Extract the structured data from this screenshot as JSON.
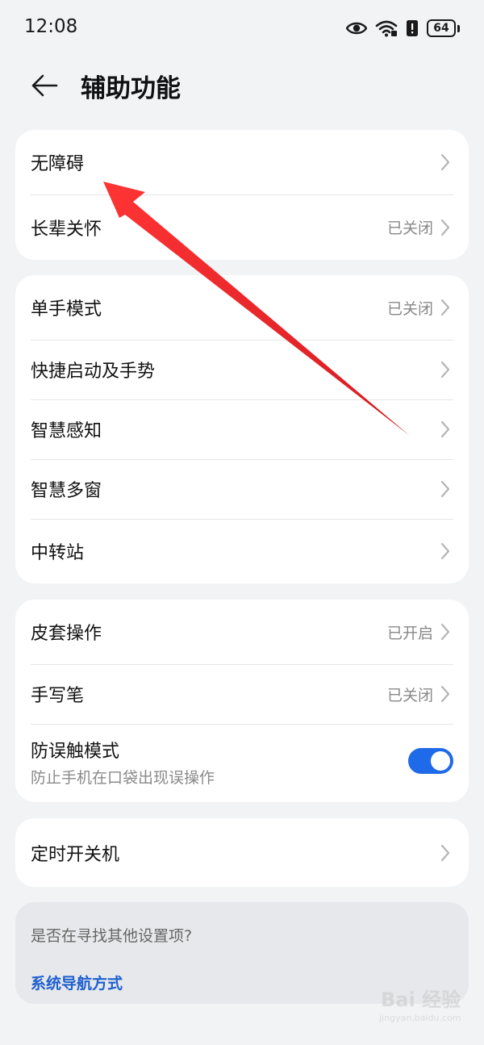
{
  "status_bar": {
    "time": "12:08",
    "battery": "64",
    "icons": [
      "eye-icon",
      "wifi-icon",
      "alert-icon",
      "battery-icon"
    ]
  },
  "header": {
    "title": "辅助功能"
  },
  "groups": [
    {
      "items": [
        {
          "label": "无障碍",
          "status": ""
        },
        {
          "label": "长辈关怀",
          "status": "已关闭"
        }
      ]
    },
    {
      "items": [
        {
          "label": "单手模式",
          "status": "已关闭"
        },
        {
          "label": "快捷启动及手势",
          "status": ""
        },
        {
          "label": "智慧感知",
          "status": ""
        },
        {
          "label": "智慧多窗",
          "status": ""
        },
        {
          "label": "中转站",
          "status": ""
        }
      ]
    },
    {
      "items": [
        {
          "label": "皮套操作",
          "status": "已开启"
        },
        {
          "label": "手写笔",
          "status": "已关闭"
        },
        {
          "label": "防误触模式",
          "subtitle": "防止手机在口袋出现误操作",
          "toggle_on": true
        }
      ]
    },
    {
      "items": [
        {
          "label": "定时开关机",
          "status": ""
        }
      ]
    }
  ],
  "suggestion": {
    "title": "是否在寻找其他设置项?",
    "link": "系统导航方式"
  },
  "watermark": {
    "text": "Bai 经验",
    "sub": "jingyan.baidu.com"
  },
  "colors": {
    "background": "#f1f3f5",
    "card": "#ffffff",
    "accent": "#1f6ae8",
    "link": "#1f5fcf",
    "annotation_arrow": "#e3151b"
  }
}
